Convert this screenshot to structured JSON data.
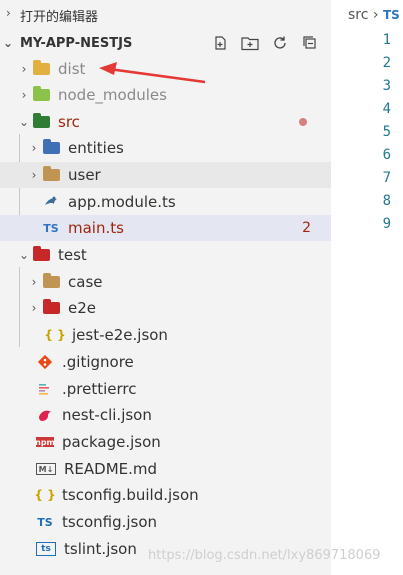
{
  "explorer": {
    "section_title": "打开的编辑器",
    "project_name": "MY-APP-NESTJS"
  },
  "tree": [
    {
      "label": "dist",
      "type": "folder",
      "icon": "dist-folder-icon",
      "color": "#e0b040",
      "state": "collapsed",
      "muted": true
    },
    {
      "label": "node_modules",
      "type": "folder",
      "icon": "node-modules-folder-icon",
      "color": "#8bc34a",
      "state": "collapsed",
      "muted": true
    },
    {
      "label": "src",
      "type": "folder",
      "icon": "src-folder-icon",
      "color": "#2e7d32",
      "state": "expanded",
      "status": "modified-dot",
      "labelColor": "#a1260d"
    },
    {
      "label": "entities",
      "type": "folder",
      "icon": "entities-folder-icon",
      "color": "#3f6fb5",
      "state": "collapsed"
    },
    {
      "label": "user",
      "type": "folder",
      "icon": "folder-icon",
      "color": "#c09553",
      "state": "collapsed"
    },
    {
      "label": "app.module.ts",
      "type": "file",
      "icon": "nest-module-icon"
    },
    {
      "label": "main.ts",
      "type": "file",
      "icon": "typescript-icon",
      "badge": "2",
      "labelColor": "#a1260d",
      "icon_text": "TS"
    },
    {
      "label": "test",
      "type": "folder",
      "icon": "test-folder-icon",
      "color": "#c62828",
      "state": "expanded"
    },
    {
      "label": "case",
      "type": "folder",
      "icon": "folder-icon",
      "color": "#c09553",
      "state": "collapsed"
    },
    {
      "label": "e2e",
      "type": "folder",
      "icon": "e2e-folder-icon",
      "color": "#c62828",
      "state": "collapsed"
    },
    {
      "label": "jest-e2e.json",
      "type": "file",
      "icon": "json-icon",
      "icon_text": "{ }"
    },
    {
      "label": ".gitignore",
      "type": "file",
      "icon": "git-icon"
    },
    {
      "label": ".prettierrc",
      "type": "file",
      "icon": "prettier-icon"
    },
    {
      "label": "nest-cli.json",
      "type": "file",
      "icon": "nest-icon"
    },
    {
      "label": "package.json",
      "type": "file",
      "icon": "npm-icon",
      "icon_text": "npm"
    },
    {
      "label": "README.md",
      "type": "file",
      "icon": "markdown-icon",
      "icon_text": "M↓"
    },
    {
      "label": "tsconfig.build.json",
      "type": "file",
      "icon": "json-icon",
      "icon_text": "{ }"
    },
    {
      "label": "tsconfig.json",
      "type": "file",
      "icon": "tsconfig-icon",
      "icon_text": "TS"
    },
    {
      "label": "tslint.json",
      "type": "file",
      "icon": "tslint-icon",
      "icon_text": "ts"
    }
  ],
  "editor": {
    "breadcrumb_folder": "src",
    "breadcrumb_file_icon": "TS",
    "line_numbers": [
      "1",
      "2",
      "3",
      "4",
      "5",
      "6",
      "7",
      "8",
      "9"
    ]
  },
  "watermark": "https://blog.csdn.net/lxy869718069",
  "colors": {
    "arrow": "#e53935",
    "selected": "#e4e6f1"
  }
}
